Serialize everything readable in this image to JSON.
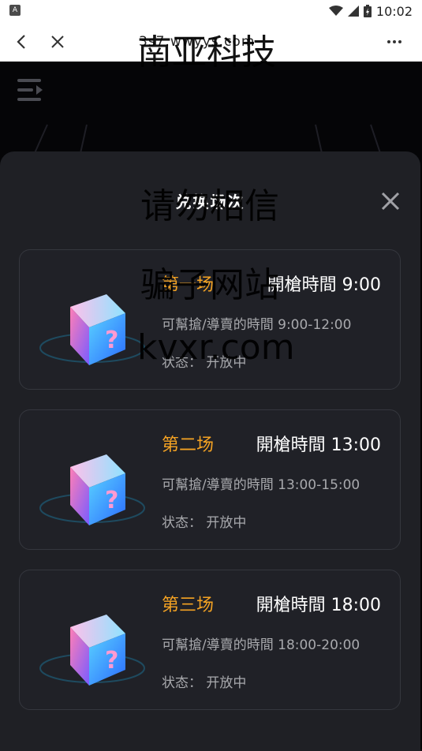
{
  "status_bar": {
    "app_badge": "A",
    "time": "10:02"
  },
  "nav": {
    "title": "3s7.wwyys.com"
  },
  "sheet": {
    "title": "兑换场次"
  },
  "sessions": [
    {
      "name": "第一场",
      "open_time": "開槍時間 9:00",
      "window": "可幫搶/導賣的時間 9:00-12:00",
      "status": "状态： 开放中"
    },
    {
      "name": "第二场",
      "open_time": "開槍時間 13:00",
      "window": "可幫搶/導賣的時間 13:00-15:00",
      "status": "状态： 开放中"
    },
    {
      "name": "第三场",
      "open_time": "開槍時間 18:00",
      "window": "可幫搶/導賣的時間 18:00-20:00",
      "status": "状态： 开放中"
    }
  ],
  "watermark": [
    "南亚科技",
    "请勿相信",
    "骗子网站",
    "kvxr.com"
  ],
  "colors": {
    "accent": "#f5a323",
    "sheet_bg": "#1f2025",
    "card_border": "#35373e"
  }
}
